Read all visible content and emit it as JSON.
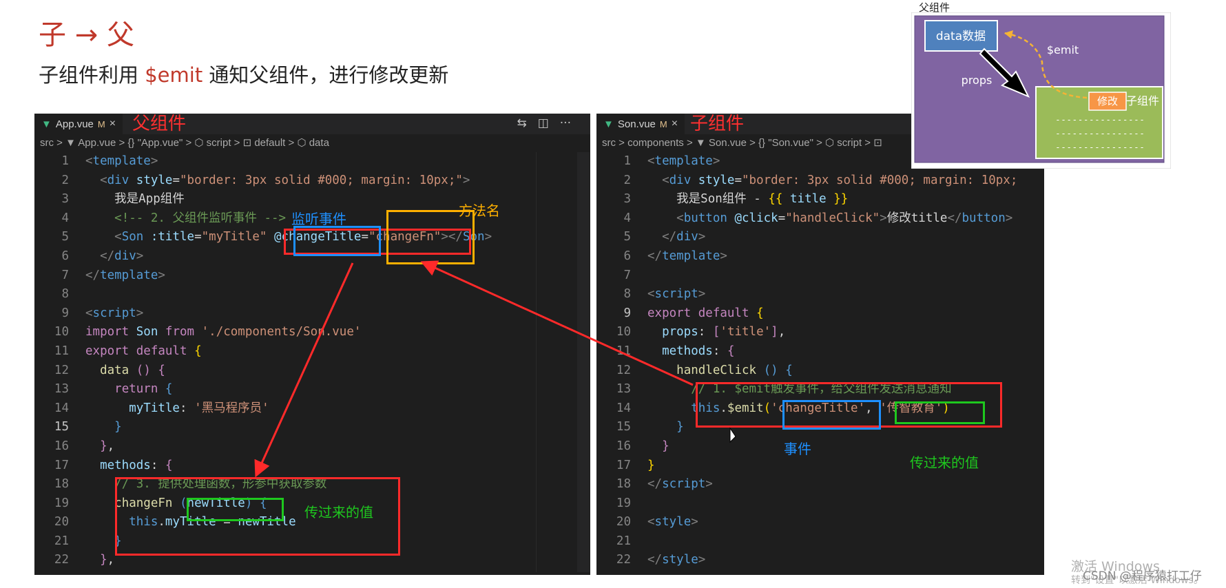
{
  "slide": {
    "title": "子 → 父",
    "subtitle_before": "子组件利用 ",
    "subtitle_highlight": "$emit",
    "subtitle_after": " 通知父组件，进行修改更新"
  },
  "left_pane": {
    "tab": {
      "icon": "vue-icon",
      "name": "App.vue",
      "modified": "M",
      "close": "×"
    },
    "tab_annotation": "父组件",
    "tools": [
      "⇆",
      "◫",
      "···"
    ],
    "breadcrumb": "src > ▼ App.vue > {} \"App.vue\" > ⬡ script > ⊡ default > ⬡ data",
    "lines": [
      {
        "n": "1",
        "html": "<span class='t-br'>&lt;</span><span class='t-tag'>template</span><span class='t-br'>&gt;</span>"
      },
      {
        "n": "2",
        "html": "  <span class='t-br'>&lt;</span><span class='t-tag'>div</span> <span class='t-attr'>style</span>=<span class='t-str'>\"border: 3px solid #000; margin: 10px;\"</span><span class='t-br'>&gt;</span>"
      },
      {
        "n": "3",
        "html": "    <span class='tx'>我是App组件</span>"
      },
      {
        "n": "4",
        "html": "    <span class='t-com'>&lt;!-- 2. 父组件监听事件 --&gt;</span>"
      },
      {
        "n": "5",
        "html": "    <span class='t-br'>&lt;</span><span class='t-tag'>Son</span> <span class='t-attr'>:title</span>=<span class='t-str'>\"myTitle\"</span> <span class='t-attr'>@changeTitle</span>=<span class='t-str'>\"changeFn\"</span><span class='t-br'>&gt;&lt;/</span><span class='t-tag'>Son</span><span class='t-br'>&gt;</span>"
      },
      {
        "n": "6",
        "html": "  <span class='t-br'>&lt;/</span><span class='t-tag'>div</span><span class='t-br'>&gt;</span>"
      },
      {
        "n": "7",
        "html": "<span class='t-br'>&lt;/</span><span class='t-tag'>template</span><span class='t-br'>&gt;</span>"
      },
      {
        "n": "8",
        "html": ""
      },
      {
        "n": "9",
        "html": "<span class='t-br'>&lt;</span><span class='t-tag'>script</span><span class='t-br'>&gt;</span>"
      },
      {
        "n": "10",
        "html": "<span class='t-kw'>import</span> <span class='t-var'>Son</span> <span class='t-kw'>from</span> <span class='t-str'>'./components/Son.vue'</span>"
      },
      {
        "n": "11",
        "html": "<span class='t-kw'>export default</span> <span class='t-y'>{</span>"
      },
      {
        "n": "12",
        "html": "  <span class='t-fn'>data</span> <span class='t-kw'>()</span> <span class='t-kw'>{</span>"
      },
      {
        "n": "13",
        "html": "    <span class='t-kw'>return</span> <span class='t-tag'>{</span>"
      },
      {
        "n": "14",
        "html": "      <span class='t-var'>myTitle</span><span class='tx'>:</span> <span class='t-str'>'黑马程序员'</span>"
      },
      {
        "n": "15",
        "html": "    <span class='t-tag'>}</span>",
        "current": true
      },
      {
        "n": "16",
        "html": "  <span class='t-kw'>}</span><span class='tx'>,</span>"
      },
      {
        "n": "17",
        "html": "  <span class='t-var'>methods</span><span class='tx'>:</span> <span class='t-kw'>{</span>"
      },
      {
        "n": "18",
        "html": "    <span class='t-com'>// 3. 提供处理函数，形参中获取参数</span>"
      },
      {
        "n": "19",
        "html": "    <span class='t-fn'>changeFn</span> <span class='t-tag'>(</span><span class='t-var'>newTitle</span><span class='t-tag'>)</span> <span class='t-tag'>{</span>"
      },
      {
        "n": "20",
        "html": "      <span class='t-this'>this</span><span class='tx'>.</span><span class='t-var'>myTitle</span> <span class='tx'>=</span> <span class='t-var'>newTitle</span>"
      },
      {
        "n": "21",
        "html": "    <span class='t-tag'>}</span>"
      },
      {
        "n": "22",
        "html": "  <span class='t-kw'>}</span><span class='tx'>,</span>"
      }
    ]
  },
  "right_pane": {
    "tab": {
      "icon": "vue-icon",
      "name": "Son.vue",
      "modified": "M",
      "close": "×"
    },
    "tab_annotation": "子组件",
    "breadcrumb": "src > components > ▼ Son.vue > {} \"Son.vue\" > ⬡ script > ⊡",
    "lines": [
      {
        "n": "1",
        "html": "<span class='t-br'>&lt;</span><span class='t-tag'>template</span><span class='t-br'>&gt;</span>"
      },
      {
        "n": "2",
        "html": "  <span class='t-br'>&lt;</span><span class='t-tag'>div</span> <span class='t-attr'>style</span>=<span class='t-str'>\"border: 3px solid #000; margin: 10px;</span>"
      },
      {
        "n": "3",
        "html": "    <span class='tx'>我是Son组件 - </span><span class='t-y'>{{</span> <span class='t-var'>title</span> <span class='t-y'>}}</span>"
      },
      {
        "n": "4",
        "html": "    <span class='t-br'>&lt;</span><span class='t-tag'>button</span> <span class='t-attr'>@click</span>=<span class='t-str'>\"handleClick\"</span><span class='t-br'>&gt;</span><span class='tx'>修改title</span><span class='t-br'>&lt;/</span><span class='t-tag'>button</span><span class='t-br'>&gt;</span>"
      },
      {
        "n": "5",
        "html": "  <span class='t-br'>&lt;/</span><span class='t-tag'>div</span><span class='t-br'>&gt;</span>"
      },
      {
        "n": "6",
        "html": "<span class='t-br'>&lt;/</span><span class='t-tag'>template</span><span class='t-br'>&gt;</span>"
      },
      {
        "n": "7",
        "html": ""
      },
      {
        "n": "8",
        "html": "<span class='t-br'>&lt;</span><span class='t-tag'>script</span><span class='t-br'>&gt;</span>"
      },
      {
        "n": "9",
        "html": "<span class='t-kw'>export default</span> <span class='t-y'>{</span>",
        "current": true
      },
      {
        "n": "10",
        "html": "  <span class='t-var'>props</span><span class='tx'>:</span> <span class='t-kw'>[</span><span class='t-str'>'title'</span><span class='t-kw'>]</span><span class='tx'>,</span>"
      },
      {
        "n": "11",
        "html": "  <span class='t-var'>methods</span><span class='tx'>:</span> <span class='t-kw'>{</span>"
      },
      {
        "n": "12",
        "html": "    <span class='t-fn'>handleClick</span> <span class='t-tag'>()</span> <span class='t-tag'>{</span>"
      },
      {
        "n": "13",
        "html": "      <span class='t-com'>// 1. $emit触发事件，给父组件发送消息通知</span>"
      },
      {
        "n": "14",
        "html": "      <span class='t-this'>this</span><span class='tx'>.</span><span class='t-fn'>$emit</span><span class='t-y'>(</span><span class='t-str'>'changeTitle'</span><span class='tx'>,</span> <span class='t-str'>'传智教育'</span><span class='t-y'>)</span>"
      },
      {
        "n": "15",
        "html": "    <span class='t-tag'>}</span>"
      },
      {
        "n": "16",
        "html": "  <span class='t-kw'>}</span>"
      },
      {
        "n": "17",
        "html": "<span class='t-y'>}</span>"
      },
      {
        "n": "18",
        "html": "<span class='t-br'>&lt;/</span><span class='t-tag'>script</span><span class='t-br'>&gt;</span>"
      },
      {
        "n": "19",
        "html": ""
      },
      {
        "n": "20",
        "html": "<span class='t-br'>&lt;</span><span class='t-tag'>style</span><span class='t-br'>&gt;</span>"
      },
      {
        "n": "21",
        "html": ""
      },
      {
        "n": "22",
        "html": "<span class='t-br'>&lt;/</span><span class='t-tag'>style</span><span class='t-br'>&gt;</span>"
      }
    ]
  },
  "annotations": {
    "listen_event": "监听事件",
    "method_name": "方法名",
    "passed_value_left": "传过来的值",
    "event": "事件",
    "passed_value_right": "传过来的值"
  },
  "diagram": {
    "parent_label": "父组件",
    "data_label": "data数据",
    "emit_label": "$emit",
    "props_label": "props",
    "modify_button": "修改",
    "child_label": "子组件",
    "dashes": "- - - - - - - - - - - - - - - -",
    "colors": {
      "parent_bg": "#8064a2",
      "child_bg": "#9bbb59",
      "data_box": "#4f81bd",
      "modify_button": "#f79646"
    }
  },
  "watermark": {
    "activate": "激活 Windows",
    "activate_sub": "转到\"设置\"以激活 Windows。",
    "csdn": "CSDN @程序猿打工仔"
  }
}
